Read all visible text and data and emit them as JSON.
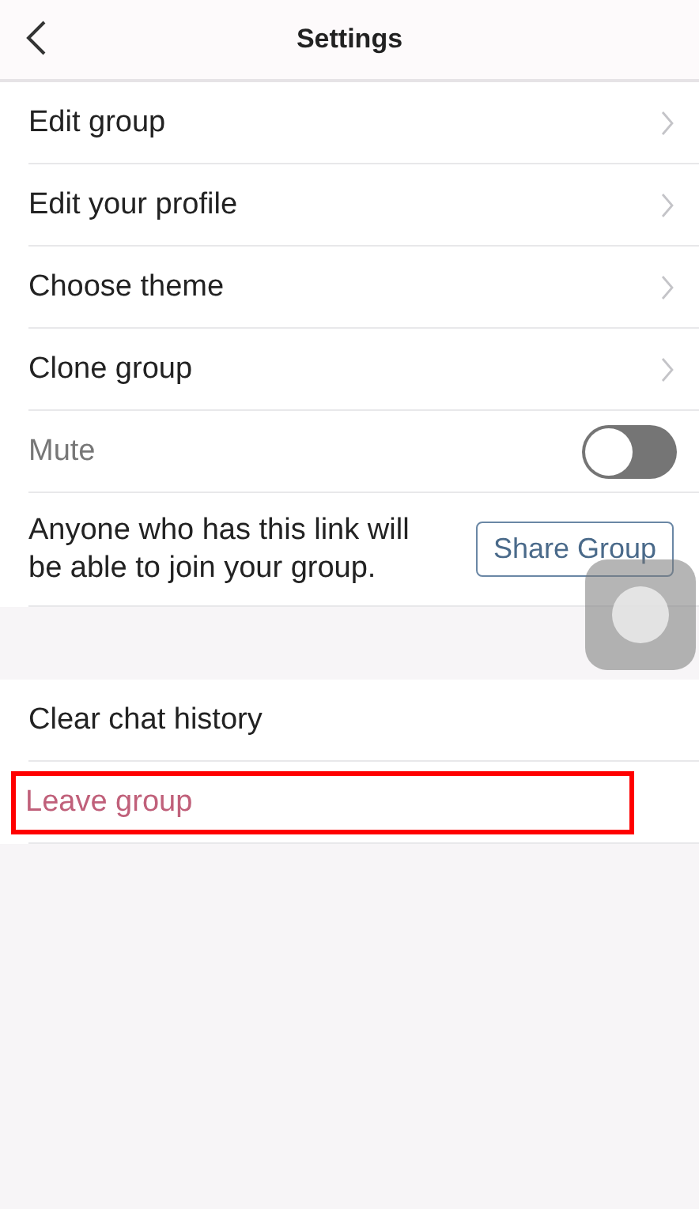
{
  "header": {
    "title": "Settings"
  },
  "sections": [
    {
      "rows": [
        {
          "kind": "link",
          "label": "Edit group"
        },
        {
          "kind": "link",
          "label": "Edit your profile"
        },
        {
          "kind": "link",
          "label": "Choose theme"
        },
        {
          "kind": "link",
          "label": "Clone group"
        },
        {
          "kind": "toggle",
          "label": "Mute",
          "on": false
        },
        {
          "kind": "share",
          "label": "Anyone who has this link will be able to join your group.",
          "button": "Share Group"
        }
      ]
    },
    {
      "rows": [
        {
          "kind": "action",
          "label": "Clear chat history",
          "danger": false,
          "highlighted": false
        },
        {
          "kind": "action",
          "label": "Leave group",
          "danger": true,
          "highlighted": true
        }
      ]
    }
  ]
}
